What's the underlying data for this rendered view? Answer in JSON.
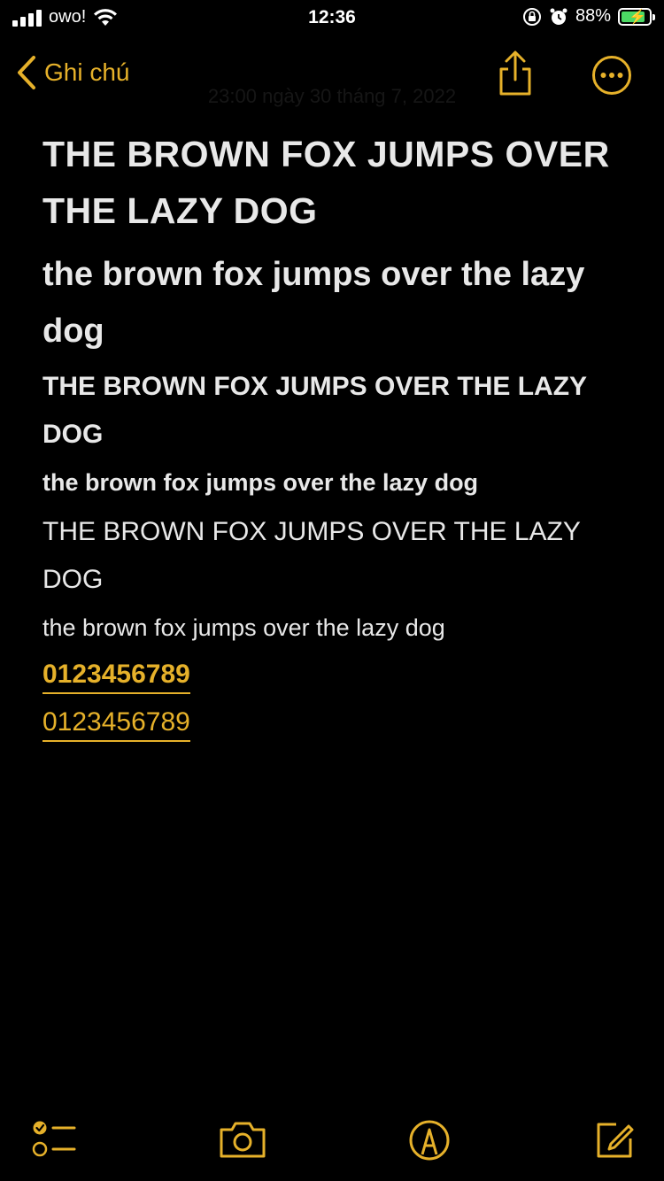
{
  "status_bar": {
    "carrier": "owo!",
    "time": "12:36",
    "battery_percent": "88%",
    "battery_level": 0.88,
    "icons": [
      "signal-icon",
      "wifi-icon",
      "orientation-lock-icon",
      "alarm-icon",
      "battery-charging-icon"
    ]
  },
  "nav": {
    "back_label": "Ghi chú",
    "icons": [
      "chevron-left-icon",
      "share-icon",
      "more-icon"
    ]
  },
  "note": {
    "faded_date": "23:00 ngày 30 tháng 7, 2022",
    "lines": [
      "THE BROWN FOX JUMPS OVER THE LAZY DOG",
      "the brown fox jumps over the lazy dog",
      "THE BROWN FOX JUMPS OVER THE LAZY DOG",
      "the brown fox jumps over the lazy dog",
      "THE BROWN FOX JUMPS OVER THE LAZY DOG",
      "the brown fox jumps over the lazy dog"
    ],
    "numbers_bold": "0123456789",
    "numbers_regular": "0123456789"
  },
  "toolbar": {
    "icons": [
      "checklist-icon",
      "camera-icon",
      "markup-icon",
      "compose-icon"
    ]
  },
  "colors": {
    "accent": "#e6b12a",
    "background": "#000000",
    "text": "#e8e8e8",
    "battery": "#4cd964"
  }
}
